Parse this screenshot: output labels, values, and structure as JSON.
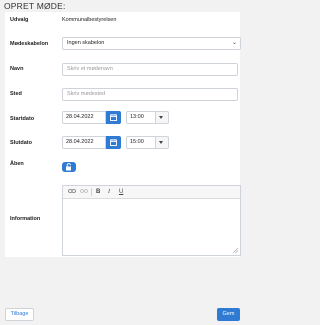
{
  "page": {
    "title": "OPRET MØDE:"
  },
  "form": {
    "udvalg": {
      "label": "Udvalg",
      "value": "Kommunalbestyrelsen"
    },
    "skabelon": {
      "label": "Mødeskabelon",
      "value": "Ingen skabelon"
    },
    "navn": {
      "label": "Navn",
      "placeholder": "Skriv et mødenavn"
    },
    "sted": {
      "label": "Sted",
      "placeholder": "Skriv mødested"
    },
    "start": {
      "label": "Startdato",
      "date": "28.04.2022",
      "time": "13:00"
    },
    "slut": {
      "label": "Slutdato",
      "date": "28.04.2022",
      "time": "15:00"
    },
    "aaben": {
      "label": "Åben",
      "checked": true
    },
    "information": {
      "label": "Information",
      "value": ""
    }
  },
  "editor_toolbar": {
    "bold": "B",
    "italic": "I",
    "underline": "U"
  },
  "actions": {
    "back": "Tilbage",
    "save": "Gem"
  },
  "colors": {
    "accent": "#2f7bd4",
    "background": "#f2f2f2",
    "card": "#ffffff",
    "border": "#cfd4da"
  }
}
